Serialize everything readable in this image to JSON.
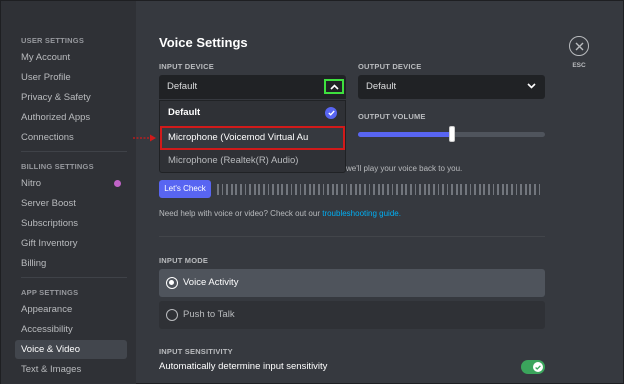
{
  "sidebar": {
    "user_settings_header": "USER SETTINGS",
    "user_items": [
      "My Account",
      "User Profile",
      "Privacy & Safety",
      "Authorized Apps",
      "Connections"
    ],
    "billing_settings_header": "BILLING SETTINGS",
    "billing_items": [
      "Nitro",
      "Server Boost",
      "Subscriptions",
      "Gift Inventory",
      "Billing"
    ],
    "app_settings_header": "APP SETTINGS",
    "app_items": [
      "Appearance",
      "Accessibility",
      "Voice & Video",
      "Text & Images"
    ],
    "active_item": "Voice & Video"
  },
  "main": {
    "title": "Voice Settings",
    "input_device": {
      "label": "INPUT DEVICE",
      "value": "Default",
      "options": [
        "Default",
        "Microphone (Voicemod Virtual Au",
        "Microphone (Realtek(R) Audio)"
      ],
      "selected_option": "Default",
      "highlighted_option": "Microphone (Voicemod Virtual Au"
    },
    "output_device": {
      "label": "OUTPUT DEVICE",
      "value": "Default"
    },
    "output_volume": {
      "label": "OUTPUT VOLUME",
      "level": 0.5
    },
    "mic_test_hint": "we'll play your voice back to you.",
    "lets_check_button": "Let's Check",
    "help_text": "Need help with voice or video? Check out our",
    "help_link": "troubleshooting guide.",
    "input_mode": {
      "label": "INPUT MODE",
      "options": [
        "Voice Activity",
        "Push to Talk"
      ],
      "selected": "Voice Activity"
    },
    "input_sensitivity": {
      "label": "INPUT SENSITIVITY",
      "auto_label": "Automatically determine input sensitivity",
      "enabled": true
    }
  },
  "close": {
    "label": "ESC"
  },
  "colors": {
    "accent": "#5865f2",
    "highlight_border": "#d11a1a",
    "focus_border": "#3ee03e",
    "toggle_on": "#3ba55c"
  },
  "icons": [
    "chevron-up-icon",
    "chevron-down-icon",
    "check-icon",
    "close-icon",
    "red-arrow-icon"
  ]
}
